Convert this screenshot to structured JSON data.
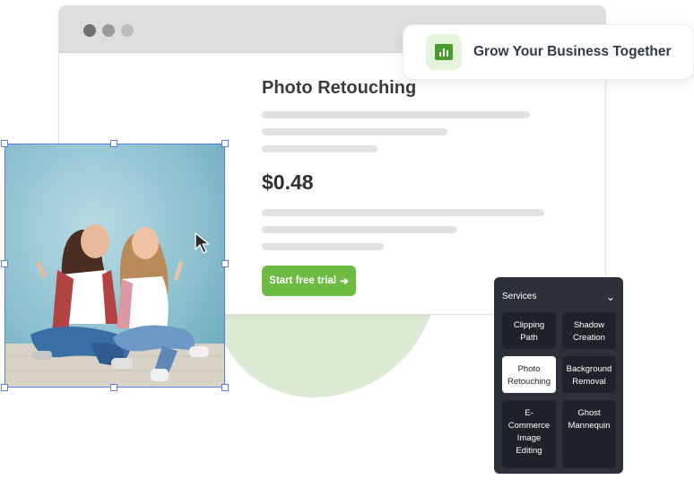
{
  "browser": {
    "product_title": "Photo Retouching",
    "price": "$0.48",
    "cta_label": "Start free trial",
    "cta_arrow": "➔"
  },
  "badge": {
    "text": "Grow Your Business Together",
    "icon": "bar-chart-icon"
  },
  "services": {
    "title": "Services",
    "chevron": "⌄",
    "items": [
      {
        "label": "Clipping Path"
      },
      {
        "label": "Shadow Creation"
      },
      {
        "label": "Photo Retouching"
      },
      {
        "label": "Background Removal"
      },
      {
        "label": "E-Commerce Image Editing"
      },
      {
        "label": "Ghost Mannequin"
      }
    ],
    "active_item": "Photo Retouching"
  },
  "colors": {
    "accent_green": "#6dbb43",
    "panel_dark": "#2c3038",
    "selection_blue": "#5b7fd4"
  }
}
